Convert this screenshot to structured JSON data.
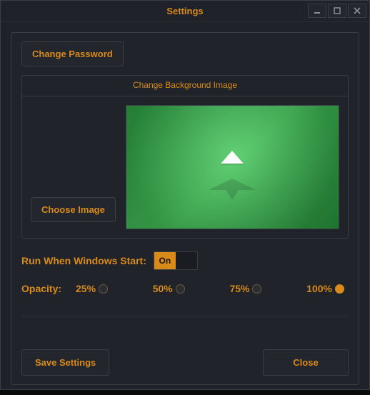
{
  "window": {
    "title": "Settings"
  },
  "buttons": {
    "change_password": "Change Password",
    "choose_image": "Choose Image",
    "save_settings": "Save Settings",
    "close": "Close"
  },
  "sections": {
    "background_legend": "Change Background Image"
  },
  "autostart": {
    "label": "Run When Windows Start:",
    "state_label": "On"
  },
  "opacity": {
    "label": "Opacity:",
    "options": [
      "25%",
      "50%",
      "75%",
      "100%"
    ],
    "selected": "100%"
  },
  "icons": {
    "minimize": "minimize-icon",
    "maximize": "maximize-icon",
    "close": "close-icon"
  },
  "colors": {
    "accent": "#d88a1a",
    "panel": "#20232a",
    "border": "#3a3d44"
  }
}
